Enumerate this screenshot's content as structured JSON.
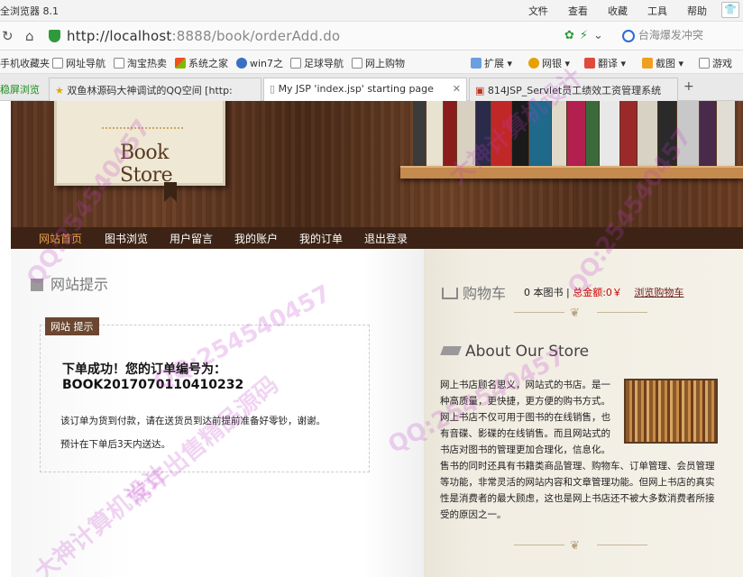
{
  "browser": {
    "app_title": "全浏览器 8.1",
    "menu": [
      "文件",
      "查看",
      "收藏",
      "工具",
      "帮助"
    ],
    "url_host": "http://localhost",
    "url_rest": ":8888/book/orderAdd.do",
    "search_text": "台海爆发冲突"
  },
  "favorites": [
    "手机收藏夹",
    "网址导航",
    "淘宝热卖",
    "系统之家",
    "win7之",
    "足球导航",
    "网上购物",
    "扩展",
    "网银",
    "翻译",
    "截图",
    "游戏"
  ],
  "tabs": {
    "first": "稳屏浏览",
    "items": [
      "双鱼林源码大神调试的QQ空间 [http:",
      "My JSP 'index.jsp' starting page",
      "814JSP_Servlet员工绩效工资管理系统"
    ]
  },
  "site": {
    "logo_text": "Book Store",
    "nav": [
      "网站首页",
      "图书浏览",
      "用户留言",
      "我的账户",
      "我的订单",
      "退出登录"
    ],
    "notice_head": "网站提示",
    "notice_tag": "网站 提示",
    "order_line1": "下单成功！您的订单编号为：",
    "order_line2": "BOOK2017070110410232",
    "para1": "该订单为货到付款，请在送货员到达前提前准备好零钞，谢谢。",
    "para2": "预计在下单后3天内送达。",
    "cart_title": "购物车",
    "cart_count": "0 本图书 |",
    "cart_total": "总金额:0￥",
    "cart_link": "浏览购物车",
    "about_title": "About Our Store",
    "about_text": "网上书店顾名思义，网站式的书店。是一种高质量，更快捷，更方便的购书方式。网上书店不仅可用于图书的在线销售，也有音碟、影碟的在线销售。而且网站式的书店对图书的管理更加合理化，信息化。售书的同时还具有书籍类商品管理、购物车、订单管理、会员管理等功能，非常灵活的网站内容和文章管理功能。但网上书店的真实性是消费者的最大顾虑，这也是网上书店还不被大多数消费者所接受的原因之一。"
  },
  "watermarks": [
    "QQ:254540457",
    "常年出售精品源码",
    "大神计算机设计"
  ]
}
